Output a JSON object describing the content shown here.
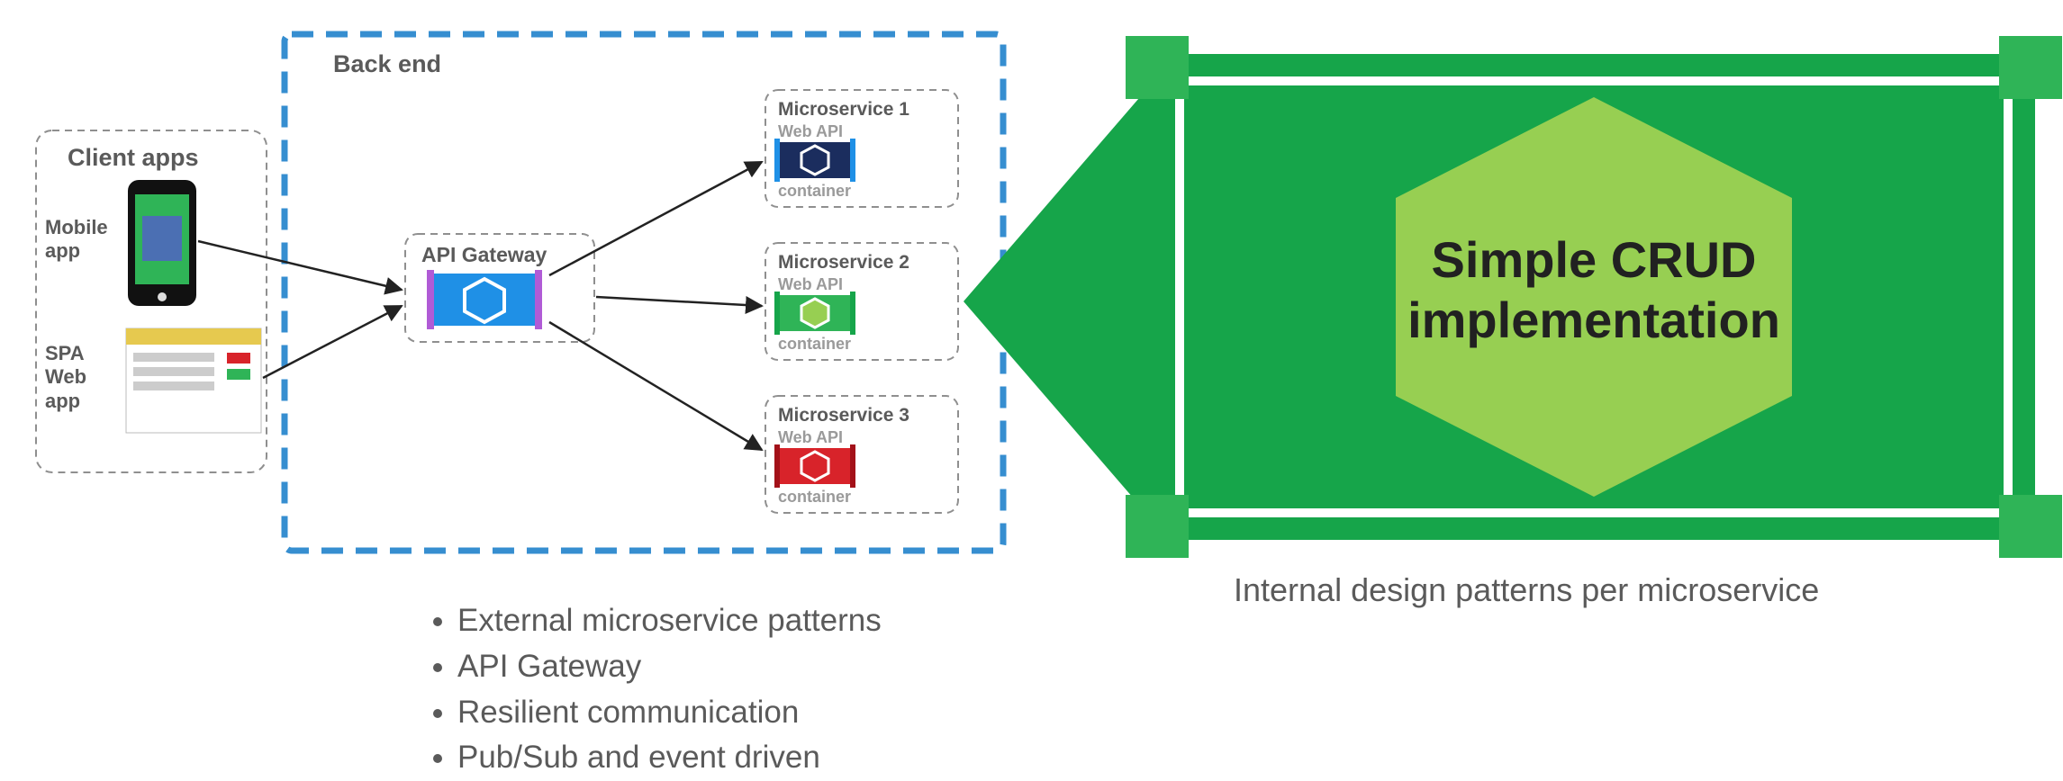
{
  "client_apps": {
    "title": "Client apps",
    "mobile_label": "Mobile app",
    "spa_label": "SPA Web app"
  },
  "backend": {
    "title": "Back end",
    "api_gateway": "API Gateway",
    "ms1": {
      "title": "Microservice 1",
      "api": "Web API",
      "container": "container"
    },
    "ms2": {
      "title": "Microservice 2",
      "api": "Web API",
      "container": "container"
    },
    "ms3": {
      "title": "Microservice 3",
      "api": "Web API",
      "container": "container"
    }
  },
  "bullets": {
    "b1": "External microservice patterns",
    "b2": "API Gateway",
    "b3": "Resilient communication",
    "b4": "Pub/Sub and event driven"
  },
  "callout": {
    "text_line1": "Simple CRUD",
    "text_line2": "implementation",
    "caption": "Internal design patterns per microservice"
  },
  "colors": {
    "dash_blue": "#368ed0",
    "dash_grey": "#8f8f8f",
    "ms1": "#1b2d5e",
    "ms2": "#2fb457",
    "ms3": "#d8232a",
    "gw": "#1f90e6",
    "callout_dark": "#16a54a",
    "callout_light": "#97cf52"
  }
}
